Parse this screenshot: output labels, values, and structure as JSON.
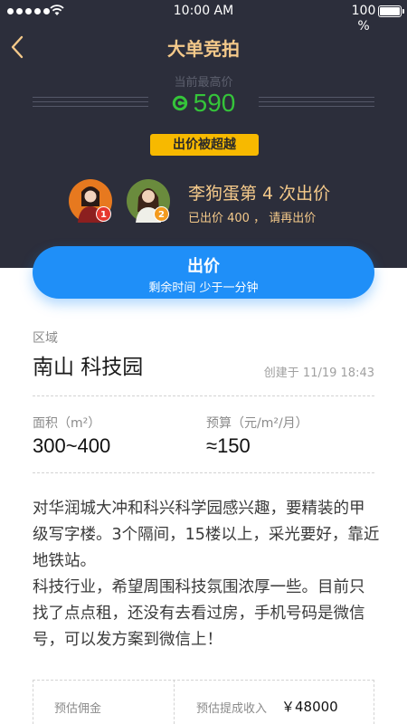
{
  "status_bar": {
    "time": "10:00 AM",
    "battery": "100 %"
  },
  "header": {
    "title": "大单竞拍",
    "back_icon": "chevron-left-icon",
    "current_bid_label": "当前最高价",
    "currency_icon": "coin-icon",
    "current_bid": "590",
    "outbid_badge": "出价被超越",
    "bidder_name": "李狗蛋第 4 次出价",
    "bidder_sub": "已出价 400 ， 请再出价",
    "avatars": [
      {
        "rank": "1",
        "color": "#e7791f"
      },
      {
        "rank": "2",
        "color": "#6a8b3d"
      }
    ]
  },
  "bid_button": {
    "label": "出价",
    "sub": "剩余时间 少于一分钟"
  },
  "details": {
    "region_label": "区域",
    "region_value": "南山 科技园",
    "created_at": "创建于 11/19 18:43",
    "area_label": "面积（m²）",
    "area_value": "300~400",
    "budget_label": "预算（元/m²/月）",
    "budget_value": "≈150",
    "description": "对华润城大冲和科兴科学园感兴趣，要精装的甲级写字楼。3个隔间，15楼以上，采光要好，靠近地铁站。\n科技行业，希望周围科技氛围浓厚一些。目前只找了点点租，还没有去看过房，手机号码是微信号，可以发方案到微信上！"
  },
  "estimate": {
    "commission_label": "预估佣金",
    "income_label": "预估提成收入",
    "income_value": "￥48000"
  },
  "colors": {
    "header_bg": "#2c2e3b",
    "accent_gold": "#f4c98a",
    "price_green": "#35c43a",
    "badge_yellow": "#f7b900",
    "button_blue": "#1f8ff8"
  }
}
